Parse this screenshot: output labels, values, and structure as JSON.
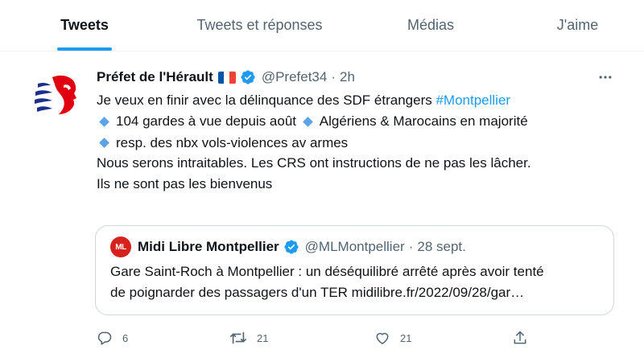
{
  "tabs": [
    {
      "label": "Tweets",
      "active": true
    },
    {
      "label": "Tweets et réponses",
      "active": false
    },
    {
      "label": "Médias",
      "active": false
    },
    {
      "label": "J'aime",
      "active": false
    }
  ],
  "tweet": {
    "author_name": "Préfet de l'Hérault",
    "flag": "french-flag-emoji",
    "verified": true,
    "handle": "@Prefet34",
    "separator": "·",
    "time": "2h",
    "text": {
      "line1": "Je veux en finir avec la délinquance des SDF étrangers ",
      "hashtag": "#Montpellier",
      "bullets": [
        "104 gardes à vue depuis août",
        "Algériens & Marocains en majorité",
        "resp. des nbx vols-violences av armes"
      ],
      "line5": "Nous serons intraitables. Les CRS ont instructions de ne pas les lâcher.",
      "line6": "Ils ne sont pas les bienvenus"
    },
    "quote": {
      "logo_text": "ML",
      "author_name": "Midi Libre Montpellier",
      "verified": true,
      "handle": "@MLMontpellier",
      "separator": "·",
      "date": "28 sept.",
      "line1": "Gare Saint-Roch à Montpellier : un déséquilibré arrêté après avoir tenté",
      "line2": "de poignarder des passagers d'un TER midilibre.fr/2022/09/28/gar…"
    },
    "actions": {
      "replies": "6",
      "retweets": "21",
      "likes": "21"
    }
  },
  "colors": {
    "accent": "#1d9bf0",
    "muted": "#536471",
    "border": "#cfd9de",
    "midi_libre_red": "#d6211d",
    "prefecture_blue": "#1b2f8f",
    "prefecture_red": "#e1000f"
  },
  "icons": [
    "more-icon",
    "verified-badge-icon",
    "reply-icon",
    "retweet-icon",
    "like-icon",
    "share-icon"
  ]
}
